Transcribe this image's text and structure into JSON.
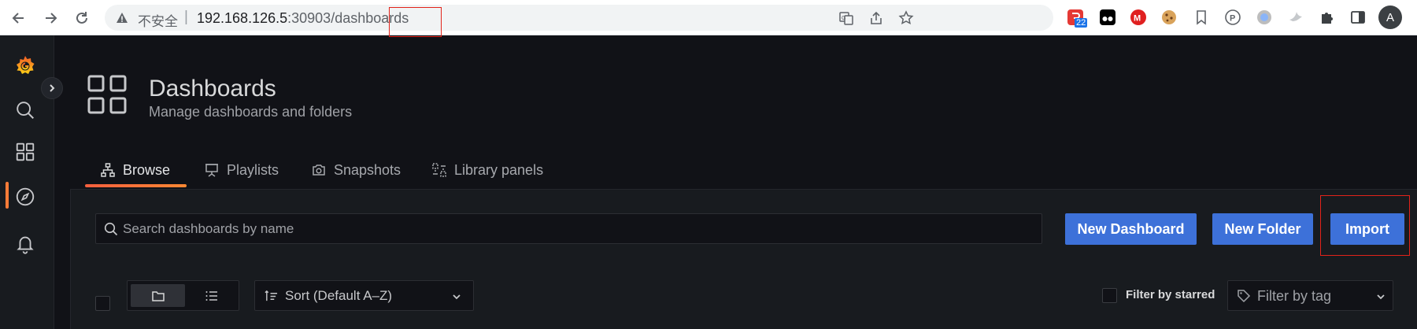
{
  "browser": {
    "insecure_label": "不安全",
    "separator": "|",
    "url_host": "192.168.126.5",
    "url_port": ":30903",
    "url_path": "/dashboards",
    "ext_badge": "22",
    "avatar_letter": "A"
  },
  "page": {
    "title": "Dashboards",
    "subtitle": "Manage dashboards and folders"
  },
  "tabs": [
    {
      "label": "Browse",
      "icon": "sitemap-icon",
      "active": true
    },
    {
      "label": "Playlists",
      "icon": "presentation-icon",
      "active": false
    },
    {
      "label": "Snapshots",
      "icon": "camera-icon",
      "active": false
    },
    {
      "label": "Library panels",
      "icon": "library-panel-icon",
      "active": false
    }
  ],
  "search": {
    "placeholder": "Search dashboards by name",
    "value": ""
  },
  "actions": {
    "new_dashboard": "New Dashboard",
    "new_folder": "New Folder",
    "import": "Import"
  },
  "toolbar": {
    "view_mode": "folders",
    "sort_label": "Sort (Default A–Z)",
    "filter_starred_label": "Filter by starred",
    "filter_tag_placeholder": "Filter by tag"
  },
  "colors": {
    "primary_button": "#3d71d9",
    "accent": "#ff7c38",
    "highlight_box": "#e2231a",
    "background": "#111217"
  }
}
